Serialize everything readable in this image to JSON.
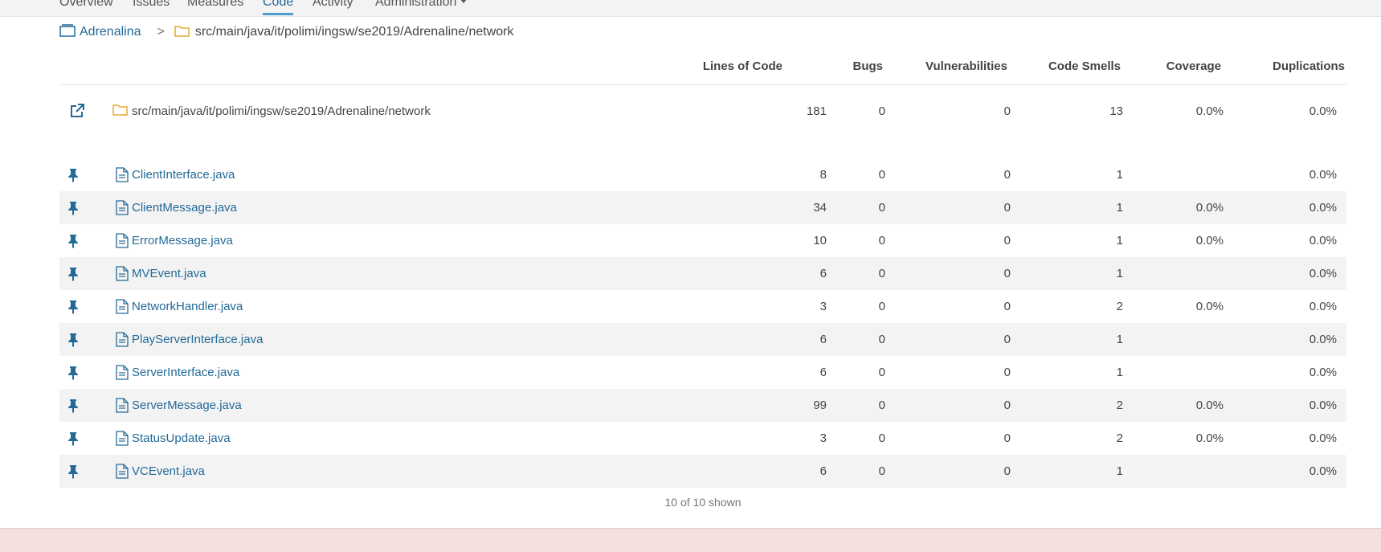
{
  "nav": {
    "items": [
      "Overview",
      "Issues",
      "Measures",
      "Code",
      "Activity",
      "Administration"
    ],
    "active": "Code"
  },
  "breadcrumb": {
    "project": "Adrenalina",
    "separator": ">",
    "path": "src/main/java/it/polimi/ingsw/se2019/Adrenaline/network"
  },
  "table": {
    "columns": [
      "Lines of Code",
      "Bugs",
      "Vulnerabilities",
      "Code Smells",
      "Coverage",
      "Duplications"
    ],
    "base_row": {
      "name": "src/main/java/it/polimi/ingsw/se2019/Adrenaline/network",
      "loc": "181",
      "bugs": "0",
      "vulns": "0",
      "smells": "13",
      "coverage": "0.0%",
      "dup": "0.0%",
      "icon": "external-link-icon"
    },
    "rows": [
      {
        "name": "ClientInterface.java",
        "loc": "8",
        "bugs": "0",
        "vulns": "0",
        "smells": "1",
        "coverage": "",
        "dup": "0.0%"
      },
      {
        "name": "ClientMessage.java",
        "loc": "34",
        "bugs": "0",
        "vulns": "0",
        "smells": "1",
        "coverage": "0.0%",
        "dup": "0.0%"
      },
      {
        "name": "ErrorMessage.java",
        "loc": "10",
        "bugs": "0",
        "vulns": "0",
        "smells": "1",
        "coverage": "0.0%",
        "dup": "0.0%"
      },
      {
        "name": "MVEvent.java",
        "loc": "6",
        "bugs": "0",
        "vulns": "0",
        "smells": "1",
        "coverage": "",
        "dup": "0.0%"
      },
      {
        "name": "NetworkHandler.java",
        "loc": "3",
        "bugs": "0",
        "vulns": "0",
        "smells": "2",
        "coverage": "0.0%",
        "dup": "0.0%"
      },
      {
        "name": "PlayServerInterface.java",
        "loc": "6",
        "bugs": "0",
        "vulns": "0",
        "smells": "1",
        "coverage": "",
        "dup": "0.0%"
      },
      {
        "name": "ServerInterface.java",
        "loc": "6",
        "bugs": "0",
        "vulns": "0",
        "smells": "1",
        "coverage": "",
        "dup": "0.0%"
      },
      {
        "name": "ServerMessage.java",
        "loc": "99",
        "bugs": "0",
        "vulns": "0",
        "smells": "2",
        "coverage": "0.0%",
        "dup": "0.0%"
      },
      {
        "name": "StatusUpdate.java",
        "loc": "3",
        "bugs": "0",
        "vulns": "0",
        "smells": "2",
        "coverage": "0.0%",
        "dup": "0.0%"
      },
      {
        "name": "VCEvent.java",
        "loc": "6",
        "bugs": "0",
        "vulns": "0",
        "smells": "1",
        "coverage": "",
        "dup": "0.0%"
      }
    ],
    "row_icons": [
      "pin-icon",
      "file-icon"
    ]
  },
  "footer": {
    "shown": "10 of 10 shown"
  },
  "colors": {
    "link": "#236a97",
    "accent": "#4b9fd5",
    "stripe": "#f3f3f3",
    "folder": "#e7a935",
    "alert_band": "#f5dfdf"
  }
}
